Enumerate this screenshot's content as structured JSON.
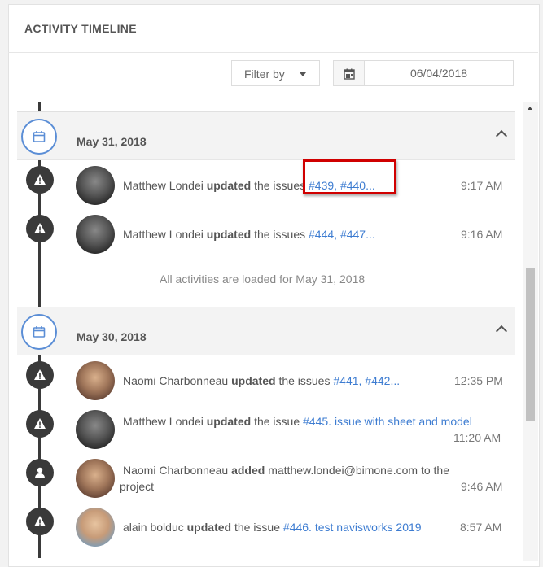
{
  "header": {
    "title": "ACTIVITY TIMELINE"
  },
  "toolbar": {
    "filter_label": "Filter by",
    "date_value": "06/04/2018"
  },
  "days": [
    {
      "date": "May 31, 2018",
      "events": [
        {
          "user": "Matthew Londei",
          "action": "updated",
          "text": "the issues",
          "link": "#439, #440...",
          "time": "9:17 AM"
        },
        {
          "user": "Matthew Londei",
          "action": "updated",
          "text": "the issues",
          "link": "#444, #447...",
          "time": "9:16 AM"
        }
      ],
      "footer": "All activities are loaded for May 31, 2018"
    },
    {
      "date": "May 30, 2018",
      "events": [
        {
          "user": "Naomi Charbonneau",
          "action": "updated",
          "text": "the issues",
          "link": "#441, #442...",
          "time": "12:35 PM"
        },
        {
          "user": "Matthew Londei",
          "action": "updated",
          "text": "the issue",
          "link": "#445. issue with sheet and model",
          "time": "11:20 AM"
        },
        {
          "user": "Naomi Charbonneau",
          "action": "added",
          "text": "matthew.londei@bimone.com",
          "text2": "to the",
          "text3": "project",
          "time": "9:46 AM"
        },
        {
          "user": "alain bolduc",
          "action": "updated",
          "text": "the issue",
          "link": "#446. test navisworks 2019",
          "time": "8:57 AM"
        }
      ]
    }
  ],
  "icons": {
    "calendar": "calendar-icon",
    "warning": "warning-icon",
    "user": "user-icon"
  },
  "colors": {
    "accent": "#3d7cd1",
    "highlight": "#d00000",
    "timeline": "#3a3a3a"
  }
}
